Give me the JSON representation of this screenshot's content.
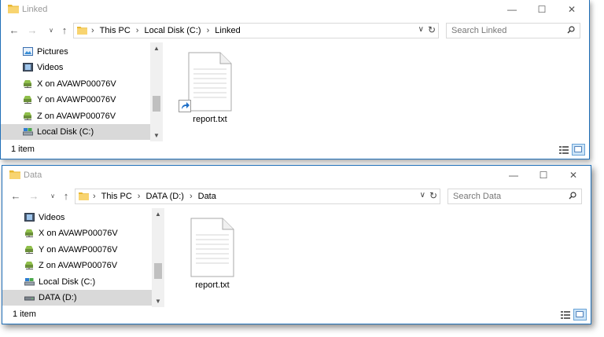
{
  "window1": {
    "title": "Linked",
    "breadcrumb": [
      "This PC",
      "Local Disk (C:)",
      "Linked"
    ],
    "search_placeholder": "Search Linked",
    "sidebar": [
      {
        "label": "Pictures",
        "icon": "pictures-icon"
      },
      {
        "label": "Videos",
        "icon": "videos-icon"
      },
      {
        "label": "X on AVAWP00076V",
        "icon": "network-drive-icon"
      },
      {
        "label": "Y on AVAWP00076V",
        "icon": "network-drive-icon"
      },
      {
        "label": "Z on AVAWP00076V",
        "icon": "network-drive-icon"
      },
      {
        "label": "Local Disk (C:)",
        "icon": "local-disk-icon",
        "selected": true
      }
    ],
    "file": {
      "name": "report.txt",
      "is_shortcut": true
    },
    "status": "1 item"
  },
  "window2": {
    "title": "Data",
    "breadcrumb": [
      "This PC",
      "DATA (D:)",
      "Data"
    ],
    "search_placeholder": "Search Data",
    "sidebar": [
      {
        "label": "Videos",
        "icon": "videos-icon"
      },
      {
        "label": "X on AVAWP00076V",
        "icon": "network-drive-icon"
      },
      {
        "label": "Y on AVAWP00076V",
        "icon": "network-drive-icon"
      },
      {
        "label": "Z on AVAWP00076V",
        "icon": "network-drive-icon"
      },
      {
        "label": "Local Disk (C:)",
        "icon": "local-disk-icon"
      },
      {
        "label": "DATA (D:)",
        "icon": "drive-icon",
        "selected": true
      }
    ],
    "file": {
      "name": "report.txt",
      "is_shortcut": false
    },
    "status": "1 item"
  },
  "colors": {
    "folder": "#f5c342",
    "border": "#1f6fb8",
    "selected": "#d9d9d9"
  }
}
